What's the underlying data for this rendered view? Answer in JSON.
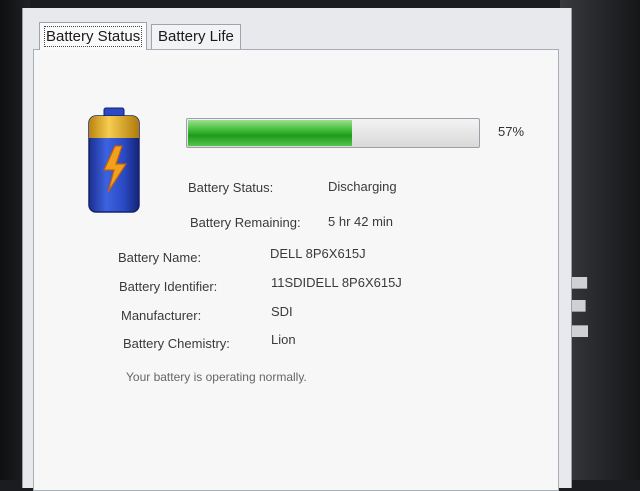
{
  "tabs": [
    {
      "label": "Battery Status",
      "active": true
    },
    {
      "label": "Battery Life",
      "active": false
    }
  ],
  "battery": {
    "icon": "battery-charging-icon",
    "percent_text": "57%",
    "percent": 57
  },
  "status": {
    "status_label": "Battery Status:",
    "status_value": "Discharging",
    "remaining_label": "Battery Remaining:",
    "remaining_value": "5 hr 42 min"
  },
  "details": [
    {
      "label": "Battery Name:",
      "value": "DELL 8P6X615J"
    },
    {
      "label": "Battery Identifier:",
      "value": "11SDIDELL 8P6X615J"
    },
    {
      "label": "Manufacturer:",
      "value": "SDI"
    },
    {
      "label": "Battery Chemistry:",
      "value": "Lion"
    }
  ],
  "message": "Your battery is operating normally.",
  "colors": {
    "progress_fill": "#2fb52b",
    "battery_body": "#2b4cc9",
    "battery_cap": "#f0b52a"
  }
}
